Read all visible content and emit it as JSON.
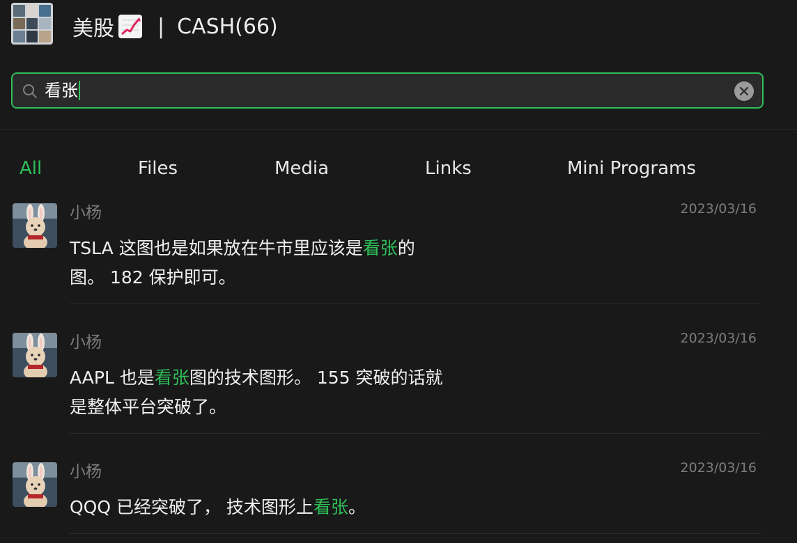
{
  "header": {
    "group_name": "美股",
    "separator": "|",
    "subtitle": "CASH(66)",
    "title_icon": "chart-increasing-icon"
  },
  "search": {
    "value": "看张",
    "icon": "search-icon"
  },
  "tabs": [
    {
      "label": "All",
      "active": true
    },
    {
      "label": "Files",
      "active": false
    },
    {
      "label": "Media",
      "active": false
    },
    {
      "label": "Links",
      "active": false
    },
    {
      "label": "Mini Programs",
      "active": false
    }
  ],
  "results": [
    {
      "sender": "小杨",
      "date": "2023/03/16",
      "line1_pre": "TSLA 这图也是如果放在牛市里应该是",
      "line1_hl": "看张",
      "line1_post": "的",
      "line2": "图。 182 保护即可。"
    },
    {
      "sender": "小杨",
      "date": "2023/03/16",
      "line1_pre": "AAPL 也是",
      "line1_hl": "看张",
      "line1_post": "图的技术图形。 155 突破的话就",
      "line2": "是整体平台突破了。"
    },
    {
      "sender": "小杨",
      "date": "2023/03/16",
      "line1_pre": "QQQ 已经突破了， 技术图形上",
      "line1_hl": "看张",
      "line1_post": "。",
      "line2": ""
    }
  ],
  "colors": {
    "accent": "#2fbf58",
    "background": "#191919",
    "muted": "#7c7c7c"
  }
}
